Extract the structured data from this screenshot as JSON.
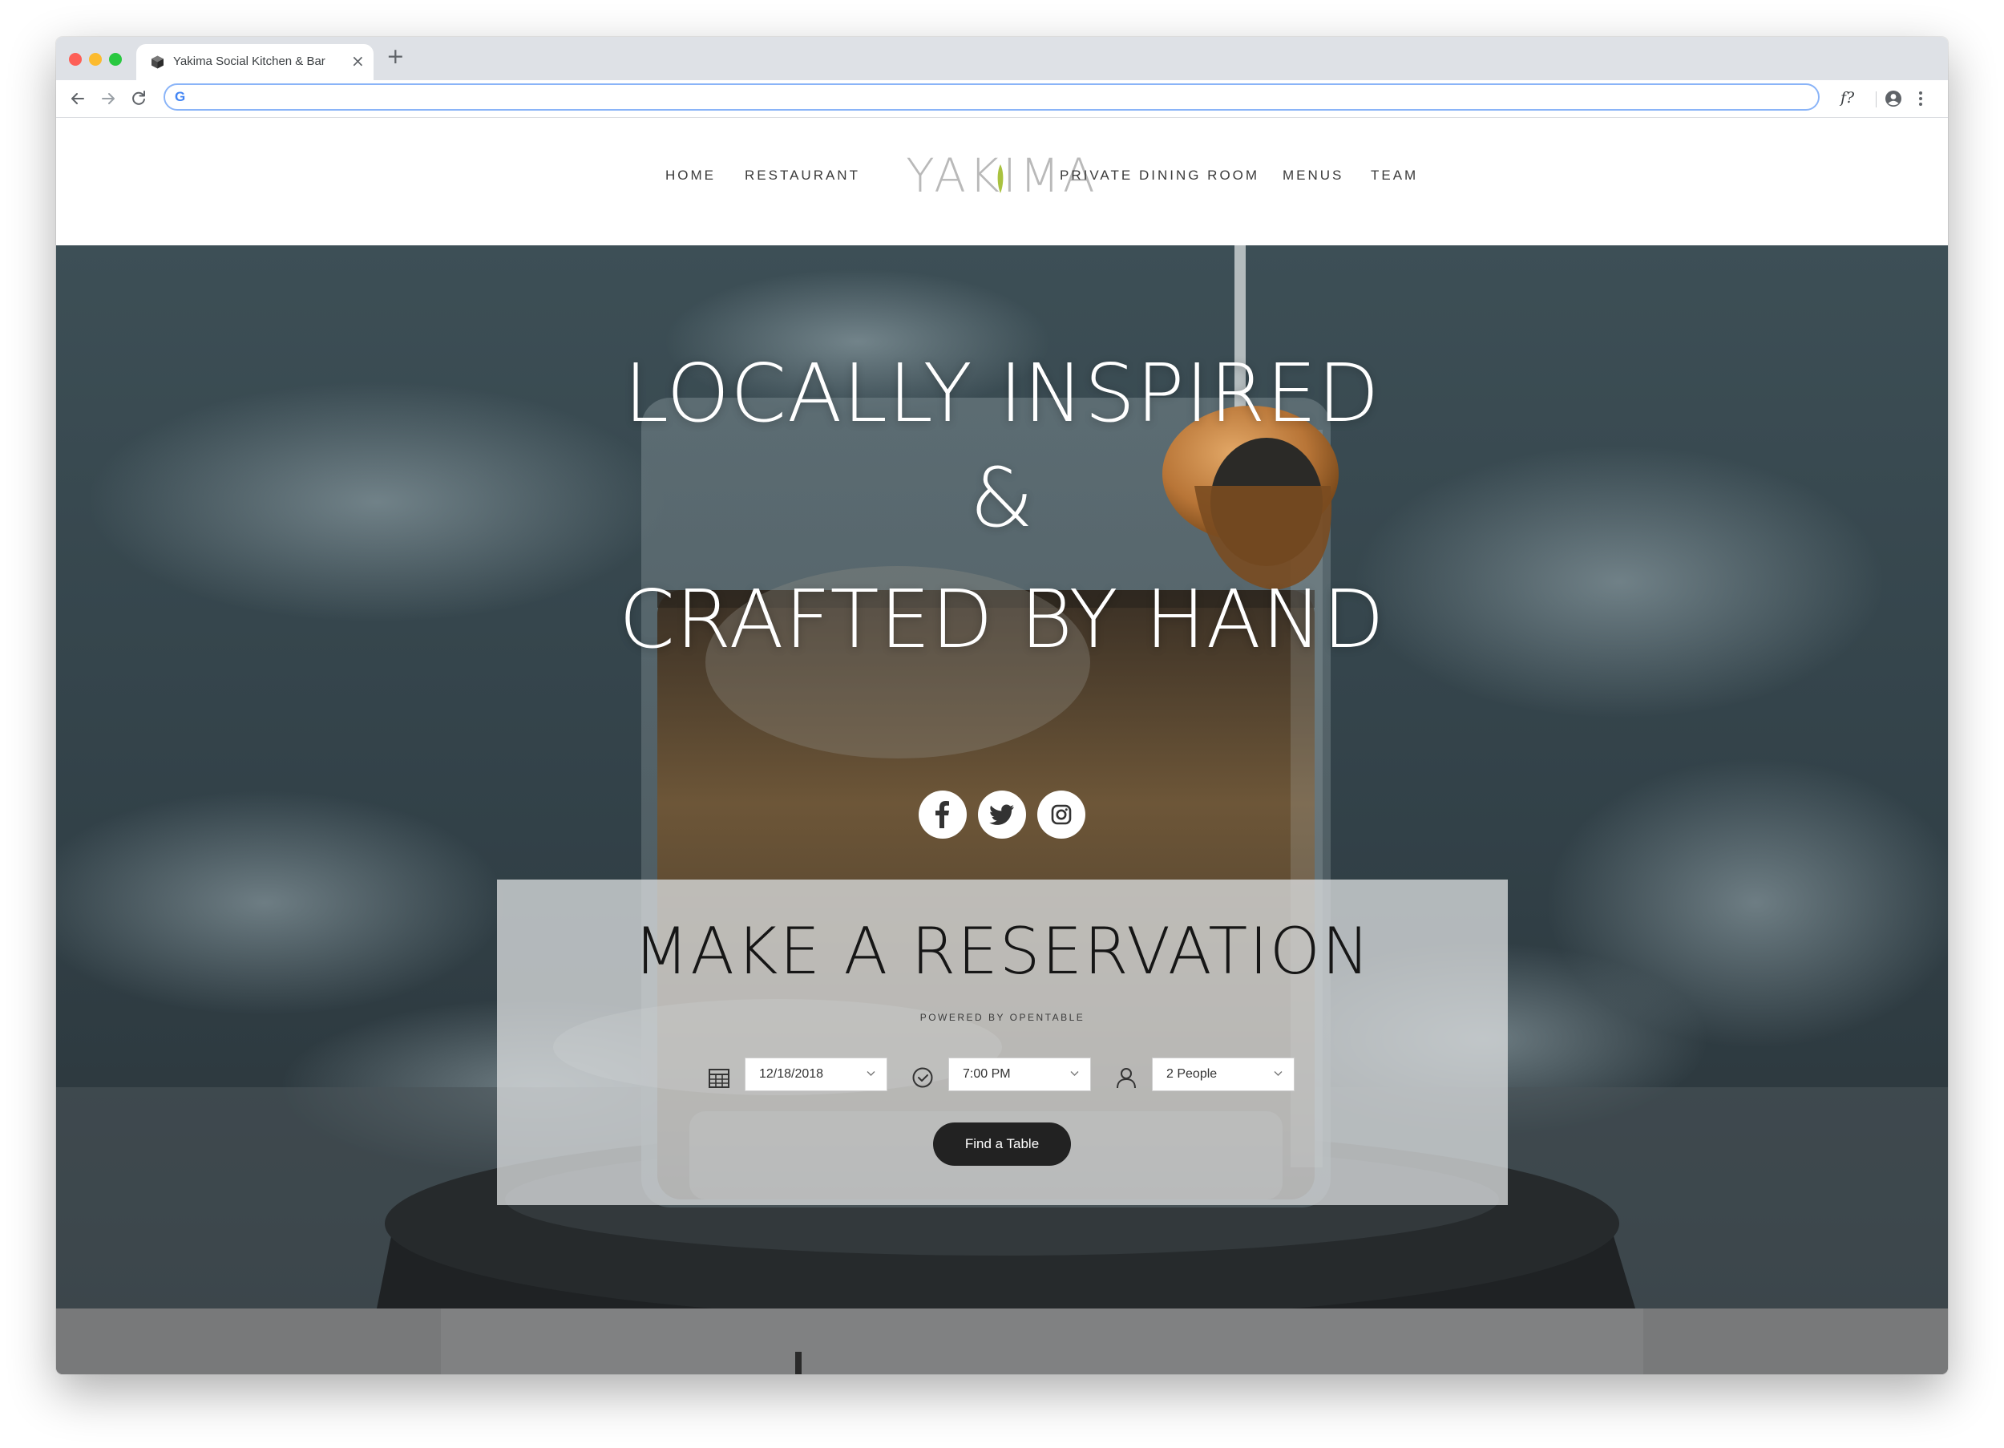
{
  "browser": {
    "tab_title": "Yakima Social Kitchen & Bar",
    "close_glyph": "×",
    "new_tab_glyph": "+",
    "address_value": "",
    "google_glyph": "G",
    "extension_glyph": "f?"
  },
  "nav": {
    "home": "HOME",
    "restaurant": "RESTAURANT",
    "private_dining": "PRIVATE DINING ROOM",
    "menus": "MENUS",
    "team": "TEAM"
  },
  "logo": {
    "text": "YAKIMA",
    "leaf_color": "#a9c23f",
    "text_color": "#b9b9b9"
  },
  "hero": {
    "line1": "LOCALLY INSPIRED",
    "line2": "&",
    "line3": "CRAFTED BY HAND",
    "social_icons": [
      "facebook-icon",
      "twitter-icon",
      "instagram-icon"
    ]
  },
  "reservation": {
    "title": "MAKE A RESERVATION",
    "powered_by": "POWERED BY OPENTABLE",
    "date": "12/18/2018",
    "time": "7:00 PM",
    "party": "2 People",
    "button": "Find a Table",
    "icons": [
      "calendar-icon",
      "clock-icon",
      "person-icon"
    ]
  },
  "colors": {
    "button_bg": "#222222",
    "panel_bg": "#d9dbdd",
    "hero_bg": "#34434a"
  }
}
